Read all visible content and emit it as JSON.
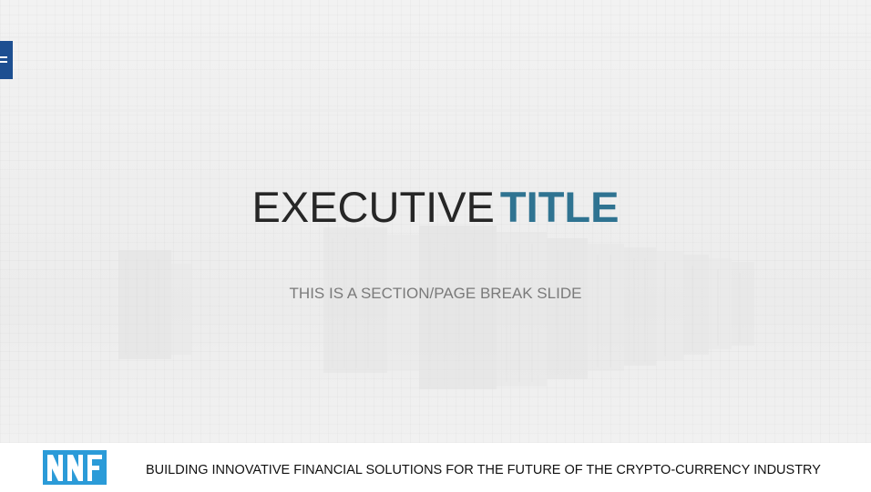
{
  "slide": {
    "title_part1": "EXECUTIVE",
    "title_part2": "TITLE",
    "subtitle": "THIS IS A SECTION/PAGE BREAK SLIDE"
  },
  "footer": {
    "tagline": "BUILDING INNOVATIVE FINANCIAL SOLUTIONS FOR THE FUTURE OF THE CRYPTO-CURRENCY INDUSTRY"
  },
  "colors": {
    "accent": "#2f7391",
    "menu_tab": "#1d4f91",
    "logo": "#2b9bd8"
  },
  "icons": {
    "menu": "hamburger-icon",
    "logo": "nnf-logo"
  }
}
